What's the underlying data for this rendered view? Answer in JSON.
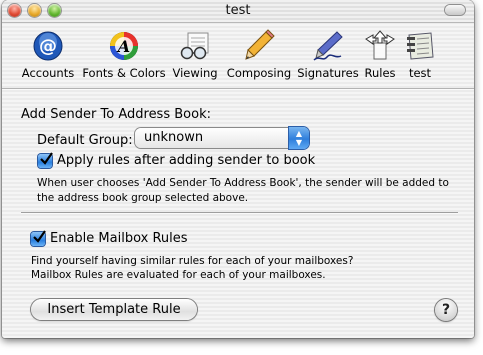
{
  "window": {
    "title": "test"
  },
  "toolbar": {
    "items": [
      {
        "label": "Accounts",
        "icon": "at-sign-icon"
      },
      {
        "label": "Fonts & Colors",
        "icon": "color-wheel-icon"
      },
      {
        "label": "Viewing",
        "icon": "glasses-letter-icon"
      },
      {
        "label": "Composing",
        "icon": "pencil-icon"
      },
      {
        "label": "Signatures",
        "icon": "pen-signature-icon"
      },
      {
        "label": "Rules",
        "icon": "rules-arrows-icon"
      },
      {
        "label": "test",
        "icon": "notepad-icon"
      }
    ]
  },
  "address_book": {
    "heading": "Add Sender To Address Book:",
    "default_group_label": "Default Group:",
    "default_group_value": "unknown",
    "apply_rules_label": "Apply rules after adding sender to book",
    "apply_rules_checked": true,
    "description": "When user chooses 'Add Sender To Address Book', the sender will be added to the address book group selected above."
  },
  "mailbox_rules": {
    "enable_label": "Enable Mailbox Rules",
    "enable_checked": true,
    "description_line1": "Find yourself having similar rules for each of your mailboxes?",
    "description_line2": "Mailbox Rules are evaluated for each of your mailboxes."
  },
  "footer": {
    "insert_template_label": "Insert Template Rule",
    "help_label": "?"
  },
  "colors": {
    "accent": "#2f7fdc",
    "close": "#e04a33",
    "minimize": "#e8a92a",
    "zoom": "#62b72f"
  }
}
